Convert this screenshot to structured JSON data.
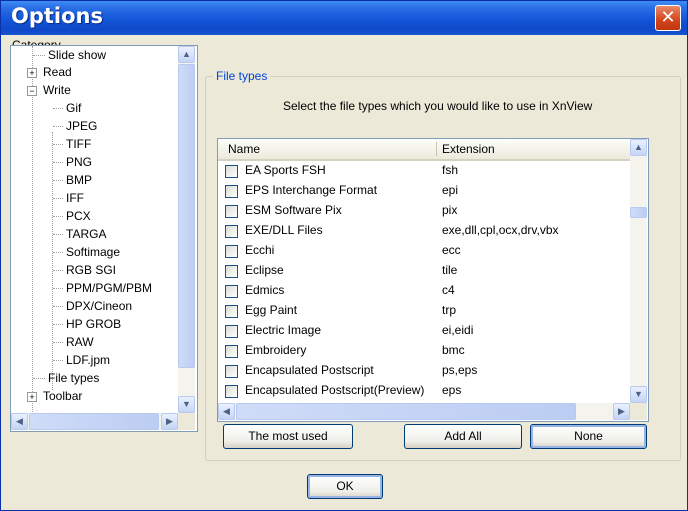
{
  "window": {
    "title": "Options",
    "close_glyph": "✕"
  },
  "category_label": "Category",
  "tree": {
    "items": [
      {
        "label": "Slide show"
      },
      {
        "label": "Read",
        "expander": "+"
      },
      {
        "label": "Write",
        "expander": "−"
      },
      {
        "label": "Gif"
      },
      {
        "label": "JPEG"
      },
      {
        "label": "TIFF"
      },
      {
        "label": "PNG"
      },
      {
        "label": "BMP"
      },
      {
        "label": "IFF"
      },
      {
        "label": "PCX"
      },
      {
        "label": "TARGA"
      },
      {
        "label": "Softimage"
      },
      {
        "label": "RGB SGI"
      },
      {
        "label": "PPM/PGM/PBM"
      },
      {
        "label": "DPX/Cineon"
      },
      {
        "label": "HP GROB"
      },
      {
        "label": "RAW"
      },
      {
        "label": "LDF.jpm"
      },
      {
        "label": "File types"
      },
      {
        "label": "Toolbar",
        "expander": "+"
      }
    ]
  },
  "filetypes": {
    "group_label": "File types",
    "description": "Select the file types which you would like to use in XnView",
    "columns": {
      "name": "Name",
      "extension": "Extension"
    },
    "rows": [
      {
        "name": "EA Sports FSH",
        "ext": "fsh",
        "checked": false
      },
      {
        "name": "EPS Interchange Format",
        "ext": "epi",
        "checked": false
      },
      {
        "name": "ESM Software Pix",
        "ext": "pix",
        "checked": false
      },
      {
        "name": "EXE/DLL Files",
        "ext": "exe,dll,cpl,ocx,drv,vbx",
        "checked": false
      },
      {
        "name": "Ecchi",
        "ext": "ecc",
        "checked": false
      },
      {
        "name": "Eclipse",
        "ext": "tile",
        "checked": false
      },
      {
        "name": "Edmics",
        "ext": "c4",
        "checked": false
      },
      {
        "name": "Egg Paint",
        "ext": "trp",
        "checked": false
      },
      {
        "name": "Electric Image",
        "ext": "ei,eidi",
        "checked": false
      },
      {
        "name": "Embroidery",
        "ext": "bmc",
        "checked": false
      },
      {
        "name": "Encapsulated Postscript",
        "ext": "ps,eps",
        "checked": false
      },
      {
        "name": "Encapsulated Postscript(Preview)",
        "ext": "eps",
        "checked": false
      }
    ]
  },
  "buttons": {
    "most_used": "The most used",
    "add_all": "Add All",
    "none": "None",
    "ok": "OK"
  },
  "scroll_glyphs": {
    "up": "▲",
    "down": "▼",
    "left": "◀",
    "right": "▶"
  },
  "colors": {
    "titlebar": "#1355d8",
    "group_label": "#0046d5",
    "close": "#d2451b"
  }
}
